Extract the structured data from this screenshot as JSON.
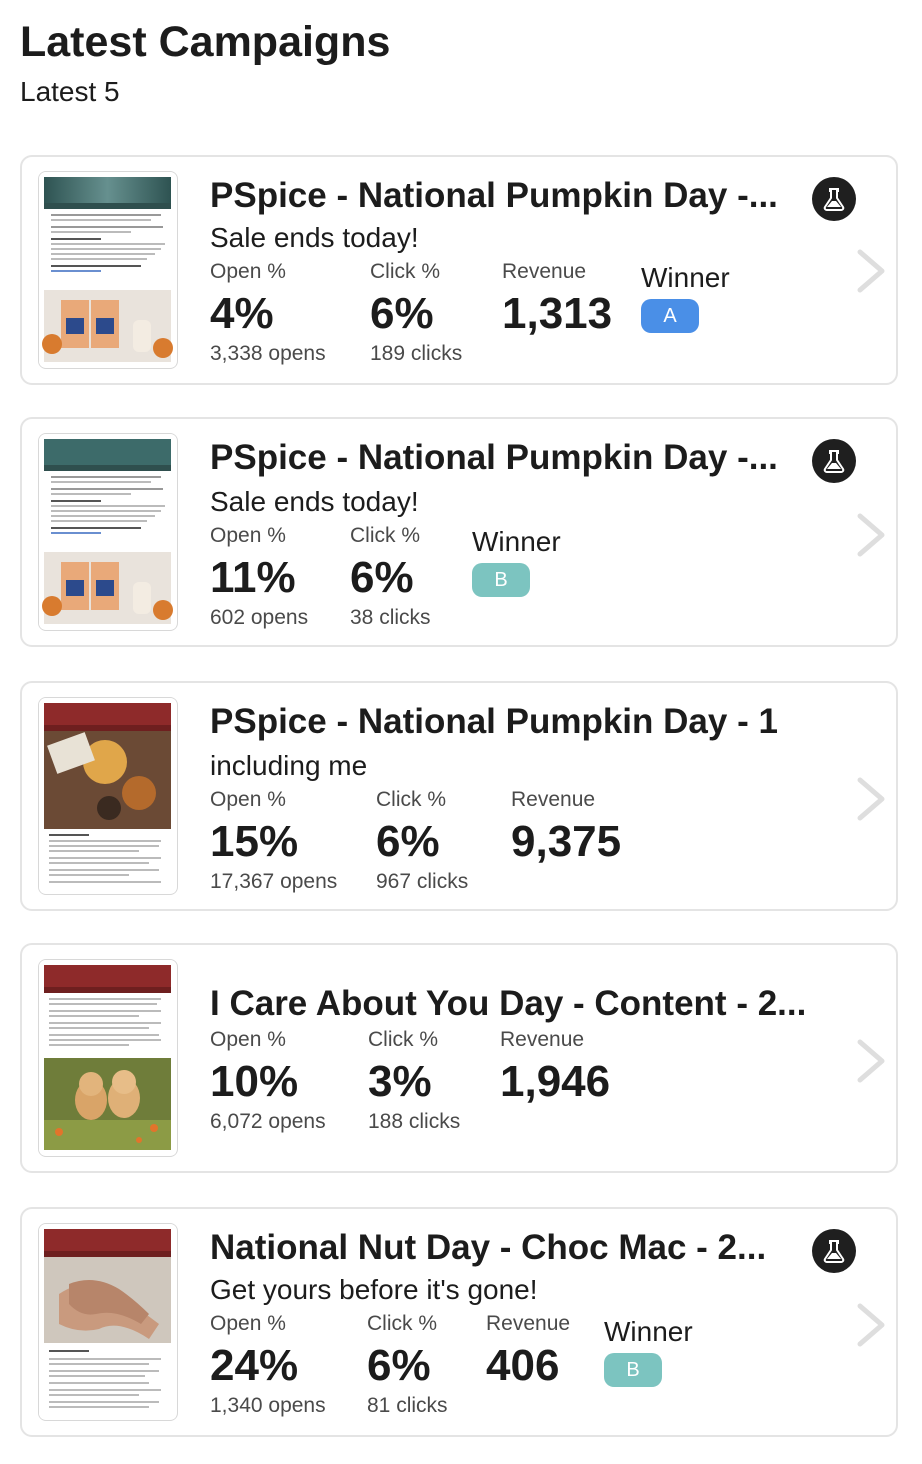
{
  "header": {
    "title": "Latest Campaigns",
    "subtitle": "Latest 5"
  },
  "colors": {
    "badge_a": "#4a8fe7",
    "badge_b": "#7cc4c0",
    "flask_bg": "#1f1f1f",
    "chevron": "#dedede"
  },
  "campaigns": [
    {
      "title": "PSpice - National Pumpkin Day -...",
      "subject": "Sale ends today!",
      "open_label": "Open %",
      "open_pct": "4%",
      "opens": "3,338 opens",
      "click_label": "Click %",
      "click_pct": "6%",
      "clicks": "189 clicks",
      "revenue_label": "Revenue",
      "revenue": "1,313",
      "winner_label": "Winner",
      "winner": "A",
      "ab_test_icon": "flask-icon"
    },
    {
      "title": "PSpice - National Pumpkin Day -...",
      "subject": "Sale ends today!",
      "open_label": "Open %",
      "open_pct": "11%",
      "opens": "602 opens",
      "click_label": "Click %",
      "click_pct": "6%",
      "clicks": "38 clicks",
      "winner_label": "Winner",
      "winner": "B",
      "ab_test_icon": "flask-icon"
    },
    {
      "title": "PSpice - National Pumpkin Day - 1",
      "subject": "including me",
      "open_label": "Open %",
      "open_pct": "15%",
      "opens": "17,367 opens",
      "click_label": "Click %",
      "click_pct": "6%",
      "clicks": "967 clicks",
      "revenue_label": "Revenue",
      "revenue": "9,375"
    },
    {
      "title": "I Care About You Day - Content - 2...",
      "open_label": "Open %",
      "open_pct": "10%",
      "opens": "6,072 opens",
      "click_label": "Click %",
      "click_pct": "3%",
      "clicks": "188 clicks",
      "revenue_label": "Revenue",
      "revenue": "1,946"
    },
    {
      "title": "National Nut Day - Choc Mac - 2...",
      "subject": "Get yours before it's gone!",
      "open_label": "Open %",
      "open_pct": "24%",
      "opens": "1,340 opens",
      "click_label": "Click %",
      "click_pct": "6%",
      "clicks": "81 clicks",
      "revenue_label": "Revenue",
      "revenue": "406",
      "winner_label": "Winner",
      "winner": "B",
      "ab_test_icon": "flask-icon"
    }
  ]
}
